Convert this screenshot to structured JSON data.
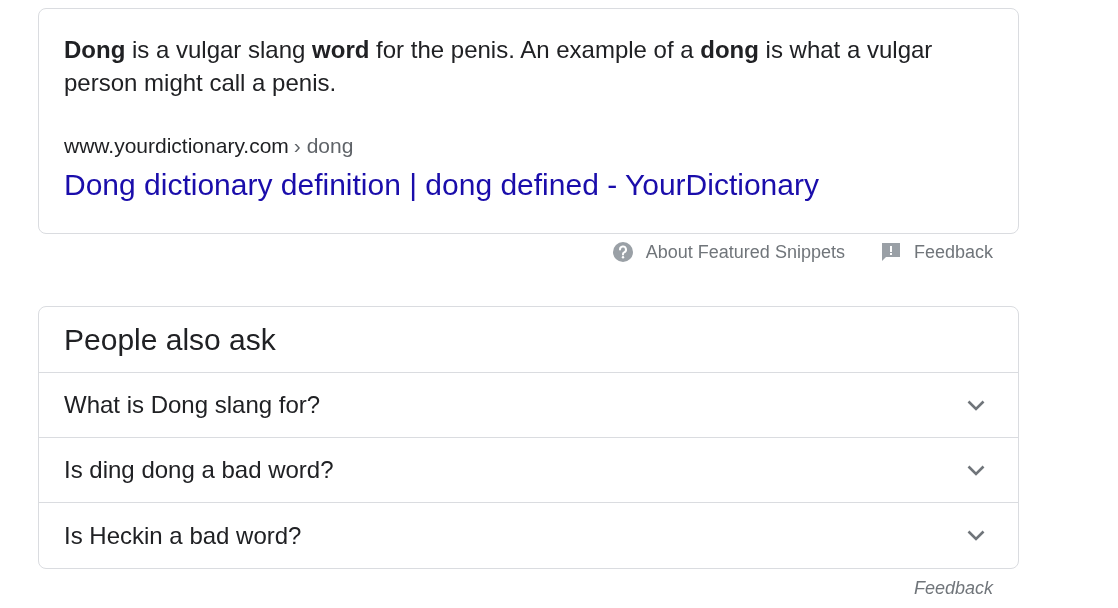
{
  "featured_snippet": {
    "text": "**Dong** is a vulgar slang **word** for the penis. An example of a **dong** is what a vulgar person might call a penis.",
    "source_site": "www.yourdictionary.com",
    "source_path": "› dong",
    "title_link": "Dong dictionary definition | dong defined - YourDictionary"
  },
  "snippet_footer": [
    {
      "kind": "help",
      "label": "About Featured Snippets"
    },
    {
      "kind": "feedback",
      "label": "Feedback"
    }
  ],
  "people_also_ask": {
    "heading": "People also ask",
    "questions": [
      {
        "text": "What is Dong slang for?",
        "expanded": false
      },
      {
        "text": "Is ding dong a bad word?",
        "expanded": false
      },
      {
        "text": "Is Heckin a bad word?",
        "expanded": false
      }
    ],
    "feedback": "Feedback"
  }
}
